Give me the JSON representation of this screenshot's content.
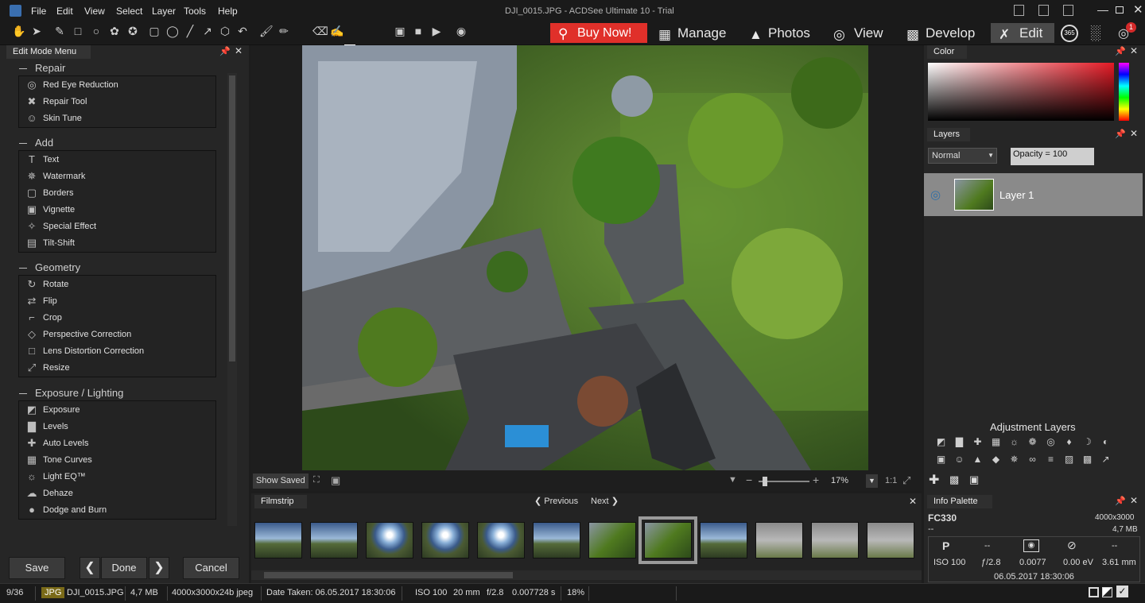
{
  "window": {
    "title": "DJI_0015.JPG - ACDSee Ultimate 10 - Trial"
  },
  "menu": [
    "File",
    "Edit",
    "View",
    "Select",
    "Layer",
    "Tools",
    "Help"
  ],
  "modes": {
    "buy": "Buy Now!",
    "manage": "Manage",
    "photos": "Photos",
    "view": "View",
    "develop": "Develop",
    "edit": "Edit",
    "badge_365": "365",
    "notify_count": "1"
  },
  "left": {
    "tab": "Edit Mode Menu",
    "groups": [
      {
        "title": "Repair",
        "items": [
          {
            "label": "Red Eye Reduction",
            "icon": "eye-icon"
          },
          {
            "label": "Repair Tool",
            "icon": "bandage-icon"
          },
          {
            "label": "Skin Tune",
            "icon": "person-icon"
          }
        ]
      },
      {
        "title": "Add",
        "items": [
          {
            "label": "Text",
            "icon": "text-icon"
          },
          {
            "label": "Watermark",
            "icon": "watermark-icon"
          },
          {
            "label": "Borders",
            "icon": "borders-icon"
          },
          {
            "label": "Vignette",
            "icon": "vignette-icon"
          },
          {
            "label": "Special Effect",
            "icon": "wand-icon"
          },
          {
            "label": "Tilt-Shift",
            "icon": "tilt-shift-icon"
          }
        ]
      },
      {
        "title": "Geometry",
        "items": [
          {
            "label": "Rotate",
            "icon": "rotate-icon"
          },
          {
            "label": "Flip",
            "icon": "flip-icon"
          },
          {
            "label": "Crop",
            "icon": "crop-icon"
          },
          {
            "label": "Perspective Correction",
            "icon": "perspective-icon"
          },
          {
            "label": "Lens Distortion Correction",
            "icon": "lens-distortion-icon"
          },
          {
            "label": "Resize",
            "icon": "resize-icon"
          }
        ]
      },
      {
        "title": "Exposure / Lighting",
        "items": [
          {
            "label": "Exposure",
            "icon": "exposure-icon"
          },
          {
            "label": "Levels",
            "icon": "levels-icon"
          },
          {
            "label": "Auto Levels",
            "icon": "auto-levels-icon"
          },
          {
            "label": "Tone Curves",
            "icon": "curves-icon"
          },
          {
            "label": "Light EQ™",
            "icon": "light-eq-icon"
          },
          {
            "label": "Dehaze",
            "icon": "dehaze-icon"
          },
          {
            "label": "Dodge and Burn",
            "icon": "dodge-burn-icon"
          }
        ]
      }
    ],
    "buttons": {
      "save": "Save",
      "done": "Done",
      "cancel": "Cancel"
    }
  },
  "viewbar": {
    "show_saved": "Show Saved",
    "zoom": "17%",
    "ratio": "1:1"
  },
  "filmstrip": {
    "tab": "Filmstrip",
    "previous": "Previous",
    "next": "Next",
    "selected_index": 7
  },
  "right": {
    "color_tab": "Color",
    "layers_tab": "Layers",
    "blend_mode": "Normal",
    "opacity": "Opacity = 100",
    "layer_name": "Layer 1",
    "adjustment_title": "Adjustment Layers",
    "info_tab": "Info Palette",
    "camera": "FC330",
    "dims": "4000x3000",
    "lens_dash": "--",
    "size": "4,7 MB",
    "mode_p": "P",
    "dash1": "--",
    "dash2": "--",
    "iso": "ISO 100",
    "aperture": "ƒ/2.8",
    "shutter": "0.0077",
    "ev": "0.00 eV",
    "focal": "3.61 mm",
    "date": "06.05.2017 18:30:06"
  },
  "status": {
    "index": "9/36",
    "format": "JPG",
    "filename": "DJI_0015.JPG",
    "filesize": "4,7 MB",
    "dimensions": "4000x3000x24b jpeg",
    "date_taken": "Date Taken: 06.05.2017 18:30:06",
    "iso": "ISO 100",
    "focal": "20 mm",
    "fstop": "f/2.8",
    "exposure": "0.007728 s",
    "zoom": "18%"
  },
  "colors": {
    "buy": "#e0302a",
    "selected_layer": "#8a8a8a",
    "panel": "#262626"
  }
}
